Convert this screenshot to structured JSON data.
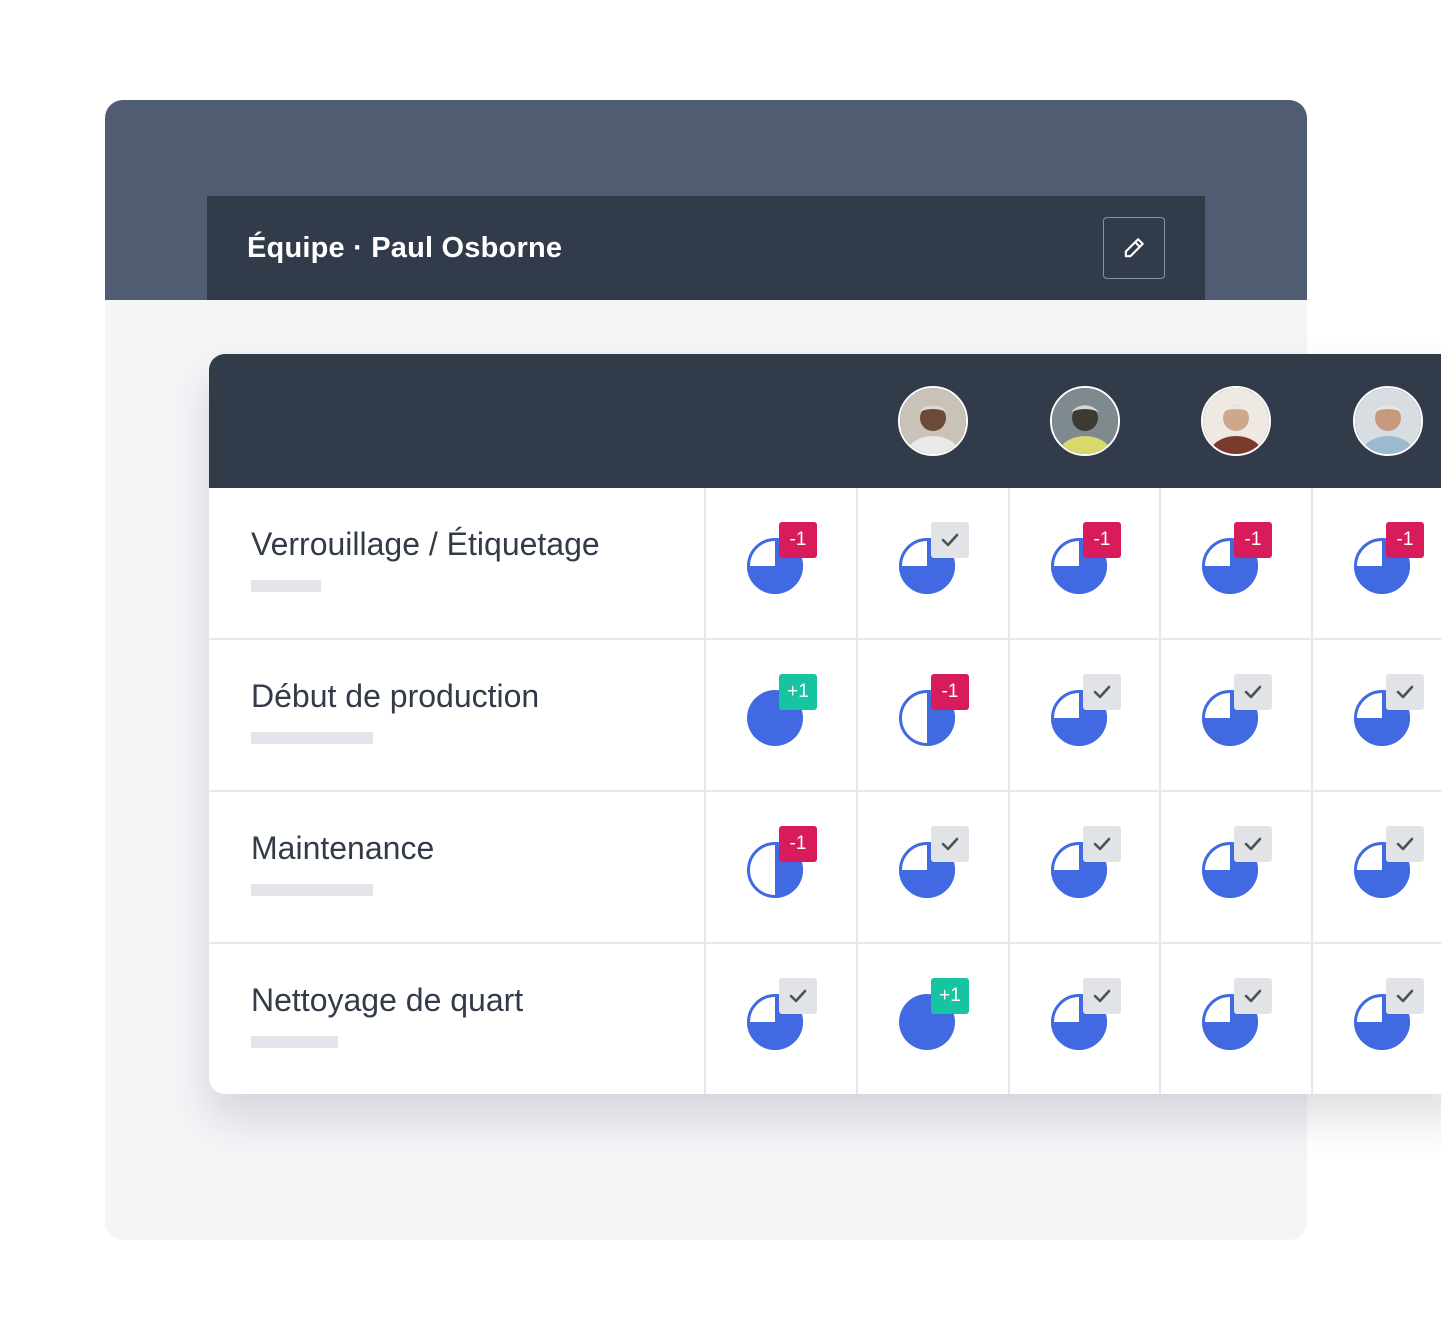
{
  "team_panel": {
    "title": "Équipe · Paul Osborne",
    "edit_icon": "pencil-icon"
  },
  "colors": {
    "pie_fill": "#4169e1",
    "badge_negative": "#d81b5a",
    "badge_positive": "#17c4a2",
    "badge_ok": "#e1e3e7",
    "header_dark": "#323b49",
    "header_slate": "#4f5c71"
  },
  "members": [
    {
      "avatar": "avatar-photo",
      "visible": false
    },
    {
      "avatar": "avatar-photo",
      "visible": true
    },
    {
      "avatar": "avatar-photo",
      "visible": true
    },
    {
      "avatar": "avatar-photo",
      "visible": true
    },
    {
      "avatar": "avatar-photo",
      "visible": true
    }
  ],
  "skills": [
    {
      "label": "Verrouillage / Étiquetage",
      "cells": [
        {
          "level": 0.75,
          "badge": "-1"
        },
        {
          "level": 0.75,
          "badge": "check"
        },
        {
          "level": 0.75,
          "badge": "-1"
        },
        {
          "level": 0.75,
          "badge": "-1"
        },
        {
          "level": 0.75,
          "badge": "-1"
        }
      ]
    },
    {
      "label": "Début de production",
      "cells": [
        {
          "level": 1.0,
          "badge": "+1"
        },
        {
          "level": 0.5,
          "badge": "-1"
        },
        {
          "level": 0.75,
          "badge": "check"
        },
        {
          "level": 0.75,
          "badge": "check"
        },
        {
          "level": 0.75,
          "badge": "check"
        }
      ]
    },
    {
      "label": "Maintenance",
      "cells": [
        {
          "level": 0.5,
          "badge": "-1"
        },
        {
          "level": 0.75,
          "badge": "check"
        },
        {
          "level": 0.75,
          "badge": "check"
        },
        {
          "level": 0.75,
          "badge": "check"
        },
        {
          "level": 0.75,
          "badge": "check"
        }
      ]
    },
    {
      "label": "Nettoyage de quart",
      "cells": [
        {
          "level": 0.75,
          "badge": "check"
        },
        {
          "level": 1.0,
          "badge": "+1"
        },
        {
          "level": 0.75,
          "badge": "check"
        },
        {
          "level": 0.75,
          "badge": "check"
        },
        {
          "level": 0.75,
          "badge": "check"
        }
      ]
    }
  ]
}
